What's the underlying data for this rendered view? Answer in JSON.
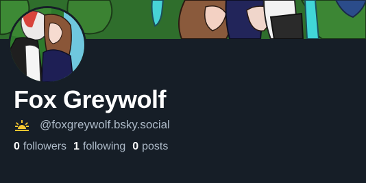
{
  "profile": {
    "display_name": "Fox Greywolf",
    "handle": "@foxgreywolf.bsky.social",
    "badge_icon": "sun-icon",
    "stats": {
      "followers_count": "0",
      "followers_label": "followers",
      "following_count": "1",
      "following_label": "following",
      "posts_count": "0",
      "posts_label": "posts"
    }
  },
  "colors": {
    "background": "#161e27",
    "name": "#ffffff",
    "secondary_text": "#aebbc9",
    "banner_grass": "#2d6a2a",
    "sun_icon": "#f4c531"
  }
}
